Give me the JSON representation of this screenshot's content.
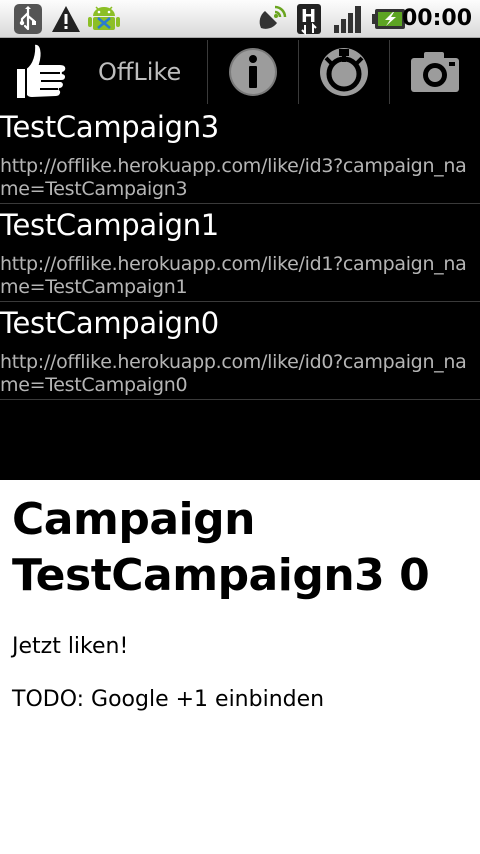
{
  "status_bar": {
    "time": "00:00",
    "icons": [
      "usb-icon",
      "warning-icon",
      "android-debug-icon",
      "gps-icon",
      "h-signal-icon",
      "signal-bars-icon",
      "battery-charging-icon"
    ]
  },
  "action_bar": {
    "app_title": "OffLike",
    "logo_icon": "thumbs-up-icon",
    "actions": [
      "info-icon",
      "timer-icon",
      "camera-icon"
    ]
  },
  "campaigns": [
    {
      "name": "TestCampaign3",
      "url": "http://offlike.herokuapp.com/like/id3?campaign_name=TestCampaign3"
    },
    {
      "name": "TestCampaign1",
      "url": "http://offlike.herokuapp.com/like/id1?campaign_name=TestCampaign1"
    },
    {
      "name": "TestCampaign0",
      "url": "http://offlike.herokuapp.com/like/id0?campaign_name=TestCampaign0"
    }
  ],
  "web_content": {
    "heading": "Campaign TestCampaign3 0",
    "paragraph1": "Jetzt liken!",
    "paragraph2": "TODO: Google +1 einbinden"
  }
}
